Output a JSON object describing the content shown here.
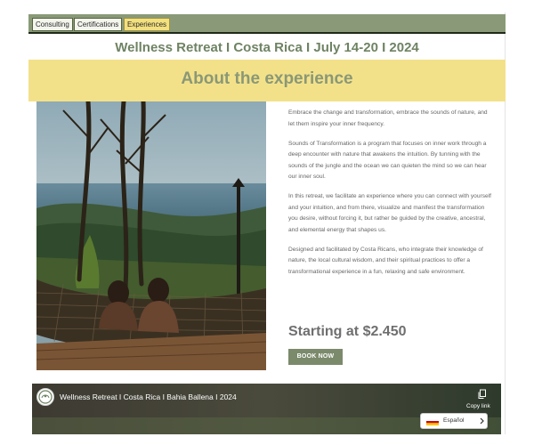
{
  "nav": {
    "tabs": [
      {
        "label": "Consulting",
        "active": false
      },
      {
        "label": "Certifications",
        "active": false
      },
      {
        "label": "Experiences",
        "active": true
      }
    ]
  },
  "hero": {
    "title": "Wellness Retreat I Costa Rica I July 14-20 I 2024"
  },
  "about": {
    "heading": "About the experience",
    "paragraphs": [
      "Embrace the change and transformation, embrace the sounds of nature, and let them inspire your inner frequency.",
      "Sounds of Transformation is a program that focuses on inner work through a deep encounter with nature that awakens the intuition. By tunning with the sounds of the jungle and the ocean we can quieten the mind so we can hear our inner soul.",
      "In this retreat, we facilitate an experience where you can connect with yourself and your intuition, and from there, visualize and manifest the transformation you desire, without forcing it, but rather be guided by the creative, ancestral, and elemental energy that shapes us.",
      "Designed and facilitated by Costa Ricans, who integrate their knowledge of nature, the local cultural wisdom, and their spiritual practices to offer a transformational experience in a fun, relaxing and safe environment."
    ],
    "price": "Starting at $2.450",
    "book_label": "BOOK NOW",
    "photo_icon": "retreat-hammock-photo"
  },
  "video": {
    "title": "Wellness Retreat I Costa Rica I Bahia Ballena I 2024",
    "copy_label": "Copy link",
    "logo_icon": "channel-logo",
    "copy_icon": "copy-icon"
  },
  "language": {
    "selected": "Español",
    "flag_icon": "spain-flag-icon",
    "chevron_icon": "chevron-right-icon"
  },
  "colors": {
    "nav_bar": "#8a9a78",
    "active_tab": "#f3e07f",
    "title_green": "#6f8363",
    "about_band": "#f3e18a",
    "button": "#7b8a6b"
  }
}
